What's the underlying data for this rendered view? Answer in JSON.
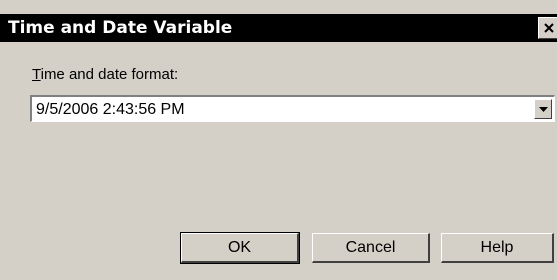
{
  "window": {
    "title": "Time and Date Variable",
    "close_icon": "close-icon"
  },
  "form": {
    "format_label_mnemonic": "T",
    "format_label_rest": "ime and date format:",
    "format_value": "9/5/2006 2:43:56 PM",
    "dropdown_icon": "chevron-down-icon"
  },
  "buttons": {
    "ok_label": "OK",
    "cancel_label": "Cancel",
    "help_label": "Help"
  },
  "colors": {
    "title_bar": "#000000",
    "dialog_face": "#d4d0c8"
  }
}
